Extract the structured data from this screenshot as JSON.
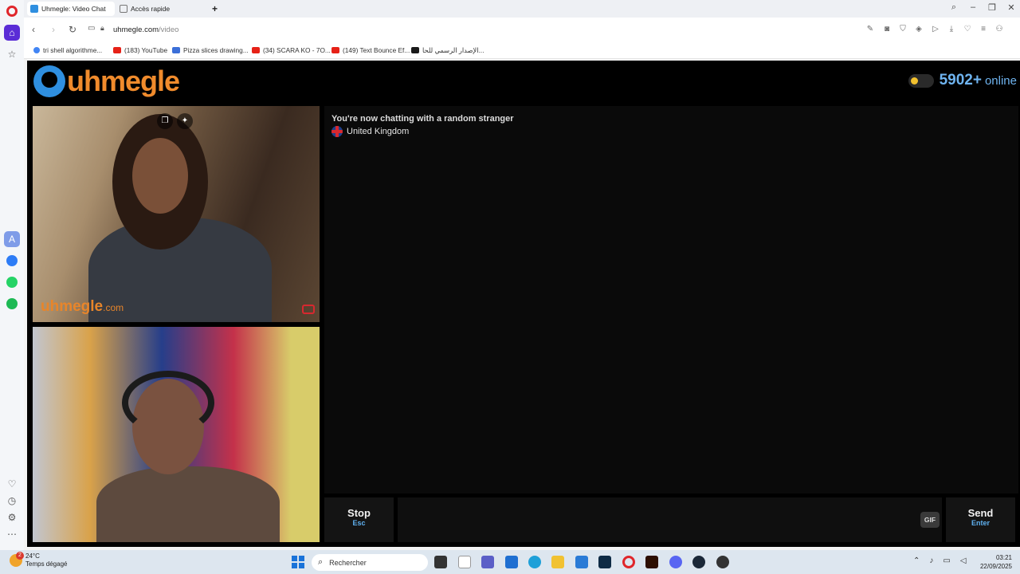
{
  "browser": {
    "tabs": [
      {
        "label": "Uhmegle: Video Chat"
      },
      {
        "label": "Accès rapide"
      }
    ],
    "new_tab": "+",
    "url_host": "uhmegle.com",
    "url_path": "/video",
    "bookmarks": [
      {
        "label": "tri shell algorithme...",
        "color": "#4285f4"
      },
      {
        "label": "(183) YouTube",
        "color": "#e62117"
      },
      {
        "label": "Pizza slices drawing...",
        "color": "#3b6fd8"
      },
      {
        "label": "(34) SCARA KO - 7O...",
        "color": "#e62117"
      },
      {
        "label": "(149) Text Bounce Ef...",
        "color": "#e62117"
      },
      {
        "label": "الإصدار الرسمي للحا...",
        "color": "#1a1a1a"
      }
    ]
  },
  "page": {
    "logo_text": "uhmegle",
    "online_count": "5902+",
    "online_label": "online",
    "watermark_main": "uhmegle",
    "watermark_tld": ".com",
    "chat_status": "You're now chatting with a random stranger",
    "country": "United Kingdom",
    "stop_label": "Stop",
    "stop_key": "Esc",
    "send_label": "Send",
    "send_key": "Enter",
    "gif_label": "GIF",
    "message_placeholder": ""
  },
  "taskbar": {
    "temperature": "24°C",
    "weather": "Temps dégagé",
    "weather_badge": "2",
    "search_placeholder": "Rechercher",
    "time": "03:21",
    "date": "22/09/2025"
  },
  "colors": {
    "brand_orange": "#f08b2c",
    "brand_blue": "#2f8fe0",
    "online_blue": "#6fb4f0",
    "key_hint_blue": "#5fb0ef"
  }
}
